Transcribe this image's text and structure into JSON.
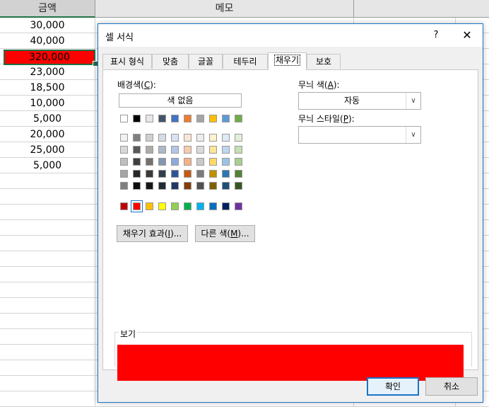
{
  "sheet": {
    "headers": [
      "금액",
      "메모"
    ],
    "values": [
      "30,000",
      "40,000",
      "320,000",
      "23,000",
      "18,500",
      "10,000",
      "5,000",
      "20,000",
      "25,000",
      "5,000"
    ],
    "active_index": 2,
    "active_fill": "#ff0000"
  },
  "dialog": {
    "title": "셀 서식",
    "help": "?",
    "close": "✕",
    "tabs": [
      "표시 형식",
      "맞춤",
      "글꼴",
      "테두리",
      "채우기",
      "보호"
    ],
    "active_tab": 4,
    "bg_color_label": "배경색(",
    "bg_color_key": "C",
    "bg_color_tail": "):",
    "no_color": "색 없음",
    "pattern_color_label": "무늬 색(",
    "pattern_color_key": "A",
    "pattern_color_tail": "):",
    "pattern_color_value": "자동",
    "pattern_style_label": "무늬 스타일(",
    "pattern_style_key": "P",
    "pattern_style_tail": "):",
    "pattern_style_value": "",
    "fill_effects_button": "채우기 효과(",
    "fill_effects_key": "I",
    "fill_effects_tail": ")...",
    "more_colors_button": "다른 색(",
    "more_colors_key": "M",
    "more_colors_tail": ")...",
    "preview_label": "보기",
    "preview_color": "#ff0000",
    "ok": "확인",
    "cancel": "취소",
    "theme_row": [
      "#ffffff",
      "#000000",
      "#e7e6e6",
      "#44546a",
      "#4472c4",
      "#ed7d31",
      "#a5a5a5",
      "#ffc000",
      "#5b9bd5",
      "#70ad47"
    ],
    "tint_rows": [
      [
        "#f2f2f2",
        "#7f7f7f",
        "#d0cece",
        "#d6dce4",
        "#d9e2f3",
        "#fbe5d5",
        "#ededed",
        "#fff2cc",
        "#deebf6",
        "#e2efd9"
      ],
      [
        "#d8d8d8",
        "#595959",
        "#aeabab",
        "#adb9ca",
        "#b4c6e7",
        "#f7cbac",
        "#dbdbdb",
        "#fee599",
        "#bdd7ee",
        "#c5e0b3"
      ],
      [
        "#bfbfbf",
        "#3f3f3f",
        "#757070",
        "#8496b0",
        "#8eaadb",
        "#f4b183",
        "#c9c9c9",
        "#ffd965",
        "#9cc3e5",
        "#a8d08d"
      ],
      [
        "#a5a5a5",
        "#262626",
        "#3a3838",
        "#323f4f",
        "#2f5496",
        "#c55a11",
        "#7b7b7b",
        "#bf9000",
        "#2e75b5",
        "#538135"
      ],
      [
        "#7f7f7f",
        "#0c0c0c",
        "#171616",
        "#222a35",
        "#1f3864",
        "#833c0b",
        "#525252",
        "#7f6000",
        "#1e4e79",
        "#375623"
      ]
    ],
    "standard_row": [
      "#c00000",
      "#ff0000",
      "#ffc000",
      "#ffff00",
      "#92d050",
      "#00b050",
      "#00b0f0",
      "#0070c0",
      "#002060",
      "#7030a0"
    ],
    "standard_selected": 1
  }
}
